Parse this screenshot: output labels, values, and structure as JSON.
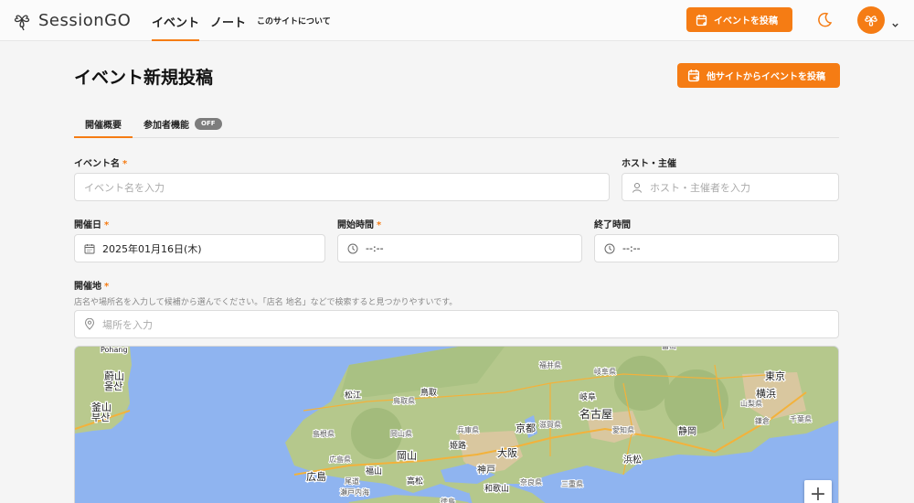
{
  "header": {
    "logo_text": "SessionGO",
    "nav": [
      {
        "label": "イベント"
      },
      {
        "label": "ノート"
      },
      {
        "label": "このサイトについて"
      }
    ],
    "post_button": "イベントを投稿"
  },
  "page": {
    "title": "イベント新規投稿",
    "import_button": "他サイトからイベントを投稿"
  },
  "tabs": [
    {
      "label": "開催概要"
    },
    {
      "label": "参加者機能",
      "badge": "OFF"
    }
  ],
  "form": {
    "event_name": {
      "label": "イベント名",
      "required": "*",
      "placeholder": "イベント名を入力"
    },
    "host": {
      "label": "ホスト・主催",
      "placeholder": "ホスト・主催者を入力"
    },
    "date": {
      "label": "開催日",
      "required": "*",
      "value": "2025年01月16日(木)"
    },
    "start_time": {
      "label": "開始時間",
      "required": "*",
      "value": "--:--"
    },
    "end_time": {
      "label": "終了時間",
      "value": "--:--"
    },
    "location": {
      "label": "開催地",
      "required": "*",
      "hint": "店名や場所名を入力して候補から選んでください。「店名 地名」などで検索すると見つかりやすいです。",
      "placeholder": "場所を入力"
    }
  },
  "map": {
    "zoom_in": "+",
    "cities": [
      "Pohang",
      "蔚山",
      "釜山",
      "부산",
      "松江",
      "鳥取",
      "岡山",
      "姫路",
      "京都",
      "大阪",
      "神戸",
      "名古屋",
      "岐阜",
      "静岡",
      "浜松",
      "東京",
      "横浜",
      "広島",
      "福山",
      "高松",
      "和歌山",
      "福井県",
      "岐阜県",
      "鳥取県",
      "島根県",
      "兵庫県",
      "滋賀県",
      "愛知県",
      "三重県",
      "奈良県",
      "広島県",
      "岡山県",
      "山梨県",
      "千葉県",
      "鎌倉",
      "尾道",
      "瀬戸内海",
      "徳島",
      "富山",
      "釜山",
      "울산"
    ]
  },
  "colors": {
    "accent": "#f57c14"
  }
}
